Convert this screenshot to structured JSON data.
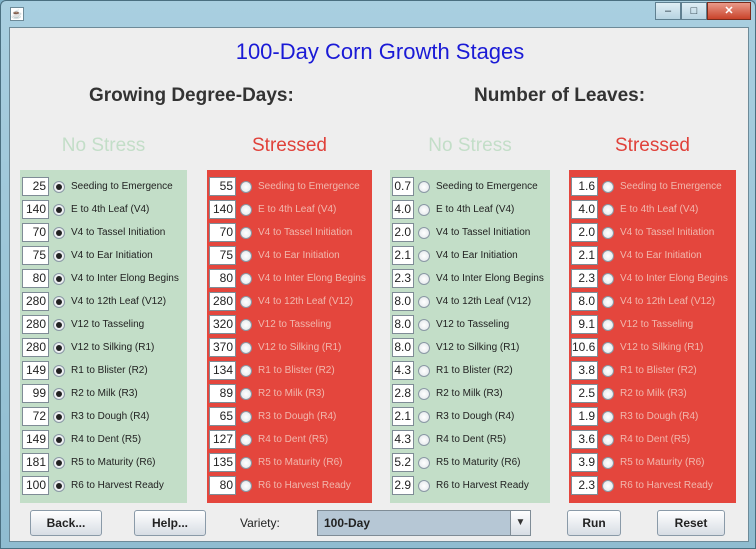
{
  "window": {
    "app_icon": "java-cup-icon",
    "controls": {
      "minimize": "–",
      "maximize": "□",
      "close": "✕"
    }
  },
  "title": "100-Day Corn Growth Stages",
  "sections": {
    "gdd": "Growing Degree-Days:",
    "leaves": "Number of Leaves:"
  },
  "col_heads": {
    "no_stress": "No Stress",
    "stressed": "Stressed"
  },
  "colors": {
    "no_stress": "#c3dec8",
    "stressed": "#e4463d",
    "title": "#1a1ad6"
  },
  "stages": [
    "Seeding to Emergence",
    "E to 4th Leaf (V4)",
    "V4 to Tassel Initiation",
    "V4 to Ear Initiation",
    "V4 to Inter Elong Begins",
    "V4 to 12th Leaf (V12)",
    "V12 to Tasseling",
    "V12 to Silking (R1)",
    "R1 to Blister (R2)",
    "R2 to Milk (R3)",
    "R3 to Dough (R4)",
    "R4 to Dent (R5)",
    "R5 to Maturity (R6)",
    "R6 to Harvest Ready"
  ],
  "panels": [
    {
      "values": [
        "25",
        "140",
        "70",
        "75",
        "80",
        "280",
        "280",
        "280",
        "149",
        "99",
        "72",
        "149",
        "181",
        "100"
      ],
      "selected": true
    },
    {
      "values": [
        "55",
        "140",
        "70",
        "75",
        "80",
        "280",
        "320",
        "370",
        "134",
        "89",
        "65",
        "127",
        "135",
        "80"
      ],
      "selected": false
    },
    {
      "values": [
        "0.7",
        "4.0",
        "2.0",
        "2.1",
        "2.3",
        "8.0",
        "8.0",
        "8.0",
        "4.3",
        "2.8",
        "2.1",
        "4.3",
        "5.2",
        "2.9"
      ],
      "selected": false
    },
    {
      "values": [
        "1.6",
        "4.0",
        "2.0",
        "2.1",
        "2.3",
        "8.0",
        "9.1",
        "10.6",
        "3.8",
        "2.5",
        "1.9",
        "3.6",
        "3.9",
        "2.3"
      ],
      "selected": false
    }
  ],
  "buttons": {
    "back": "Back...",
    "help": "Help...",
    "run": "Run",
    "reset": "Reset"
  },
  "variety": {
    "label": "Variety:",
    "value": "100-Day"
  }
}
